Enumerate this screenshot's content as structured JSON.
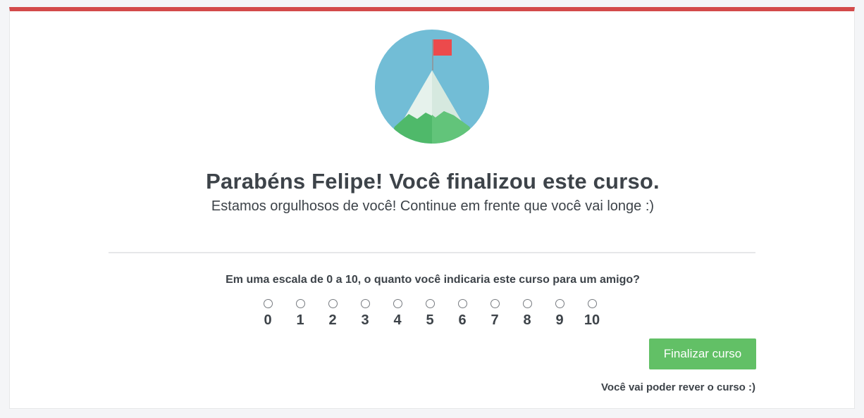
{
  "header": {
    "accent_color": "#d34a4a",
    "illustration_icon": "mountain-flag-icon"
  },
  "completion": {
    "title": "Parabéns Felipe! Você finalizou este curso.",
    "subtitle": "Estamos orgulhosos de você! Continue em frente que você vai longe :)"
  },
  "survey": {
    "question": "Em uma escala de 0 a 10, o quanto você indicaria este curso para um amigo?",
    "options": [
      "0",
      "1",
      "2",
      "3",
      "4",
      "5",
      "6",
      "7",
      "8",
      "9",
      "10"
    ],
    "selected": null
  },
  "actions": {
    "finish_label": "Finalizar curso",
    "finish_color": "#62c066",
    "note": "Você vai poder rever o curso :)"
  }
}
